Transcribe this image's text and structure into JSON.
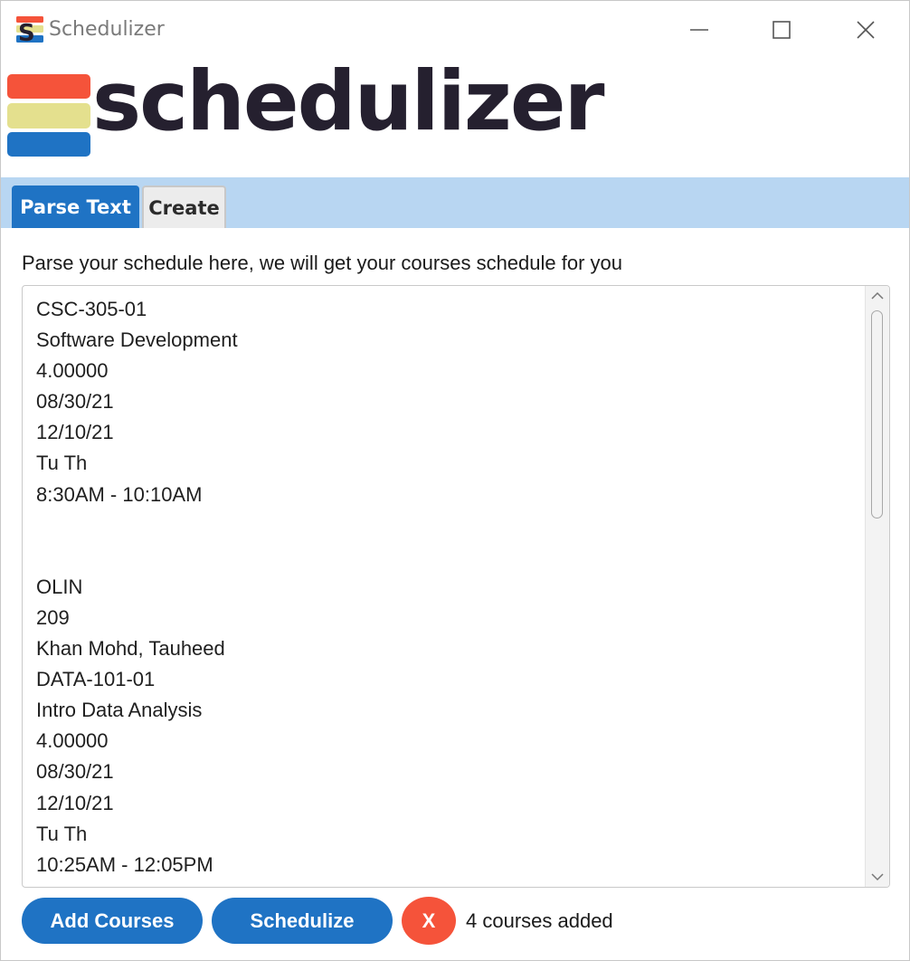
{
  "window": {
    "title": "Schedulizer",
    "icon": "schedulizer-app-icon"
  },
  "logo": {
    "text": "schedulizer",
    "bar_colors": [
      "#f5533a",
      "#e4e08e",
      "#1f73c4"
    ]
  },
  "tabs": [
    {
      "label": "Parse Text",
      "active": true
    },
    {
      "label": "Create",
      "active": false
    }
  ],
  "parse": {
    "instruction": "Parse your schedule here, we will get your courses schedule for you",
    "lines": [
      "CSC-305-01",
      "Software Development",
      "4.00000",
      "08/30/21",
      "12/10/21",
      "Tu Th",
      "8:30AM - 10:10AM",
      "",
      "",
      "OLIN",
      "209",
      "Khan Mohd, Tauheed",
      "DATA-101-01",
      "Intro Data Analysis",
      "4.00000",
      "08/30/21",
      "12/10/21",
      "Tu Th",
      "10:25AM - 12:05PM"
    ]
  },
  "actions": {
    "add_label": "Add Courses",
    "schedulize_label": "Schedulize",
    "clear_label": "X",
    "status": "4 courses added"
  },
  "colors": {
    "accent": "#1f73c4",
    "tabbar": "#b8d6f2",
    "danger": "#f5533a"
  }
}
